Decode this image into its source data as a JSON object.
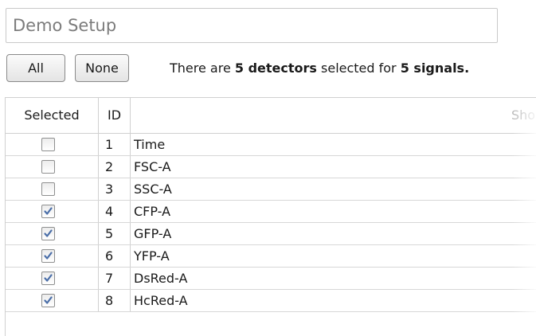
{
  "setup": {
    "name_value": "Demo Setup"
  },
  "buttons": {
    "all_label": "All",
    "none_label": "None"
  },
  "status": {
    "prefix": "There are ",
    "detector_count_label": "5 detectors",
    "middle": " selected for ",
    "signal_count_label": "5 signals."
  },
  "table": {
    "headers": {
      "selected": "Selected",
      "id": "ID",
      "short_name": "Sho"
    },
    "rows": [
      {
        "id": "1",
        "name": "Time",
        "selected": false
      },
      {
        "id": "2",
        "name": "FSC-A",
        "selected": false
      },
      {
        "id": "3",
        "name": "SSC-A",
        "selected": false
      },
      {
        "id": "4",
        "name": "CFP-A",
        "selected": true
      },
      {
        "id": "5",
        "name": "GFP-A",
        "selected": true
      },
      {
        "id": "6",
        "name": "YFP-A",
        "selected": true
      },
      {
        "id": "7",
        "name": "DsRed-A",
        "selected": true
      },
      {
        "id": "8",
        "name": "HcRed-A",
        "selected": true
      }
    ]
  },
  "colors": {
    "check_mark": "#4a6ea8",
    "grid_line": "#d0d0d0"
  }
}
